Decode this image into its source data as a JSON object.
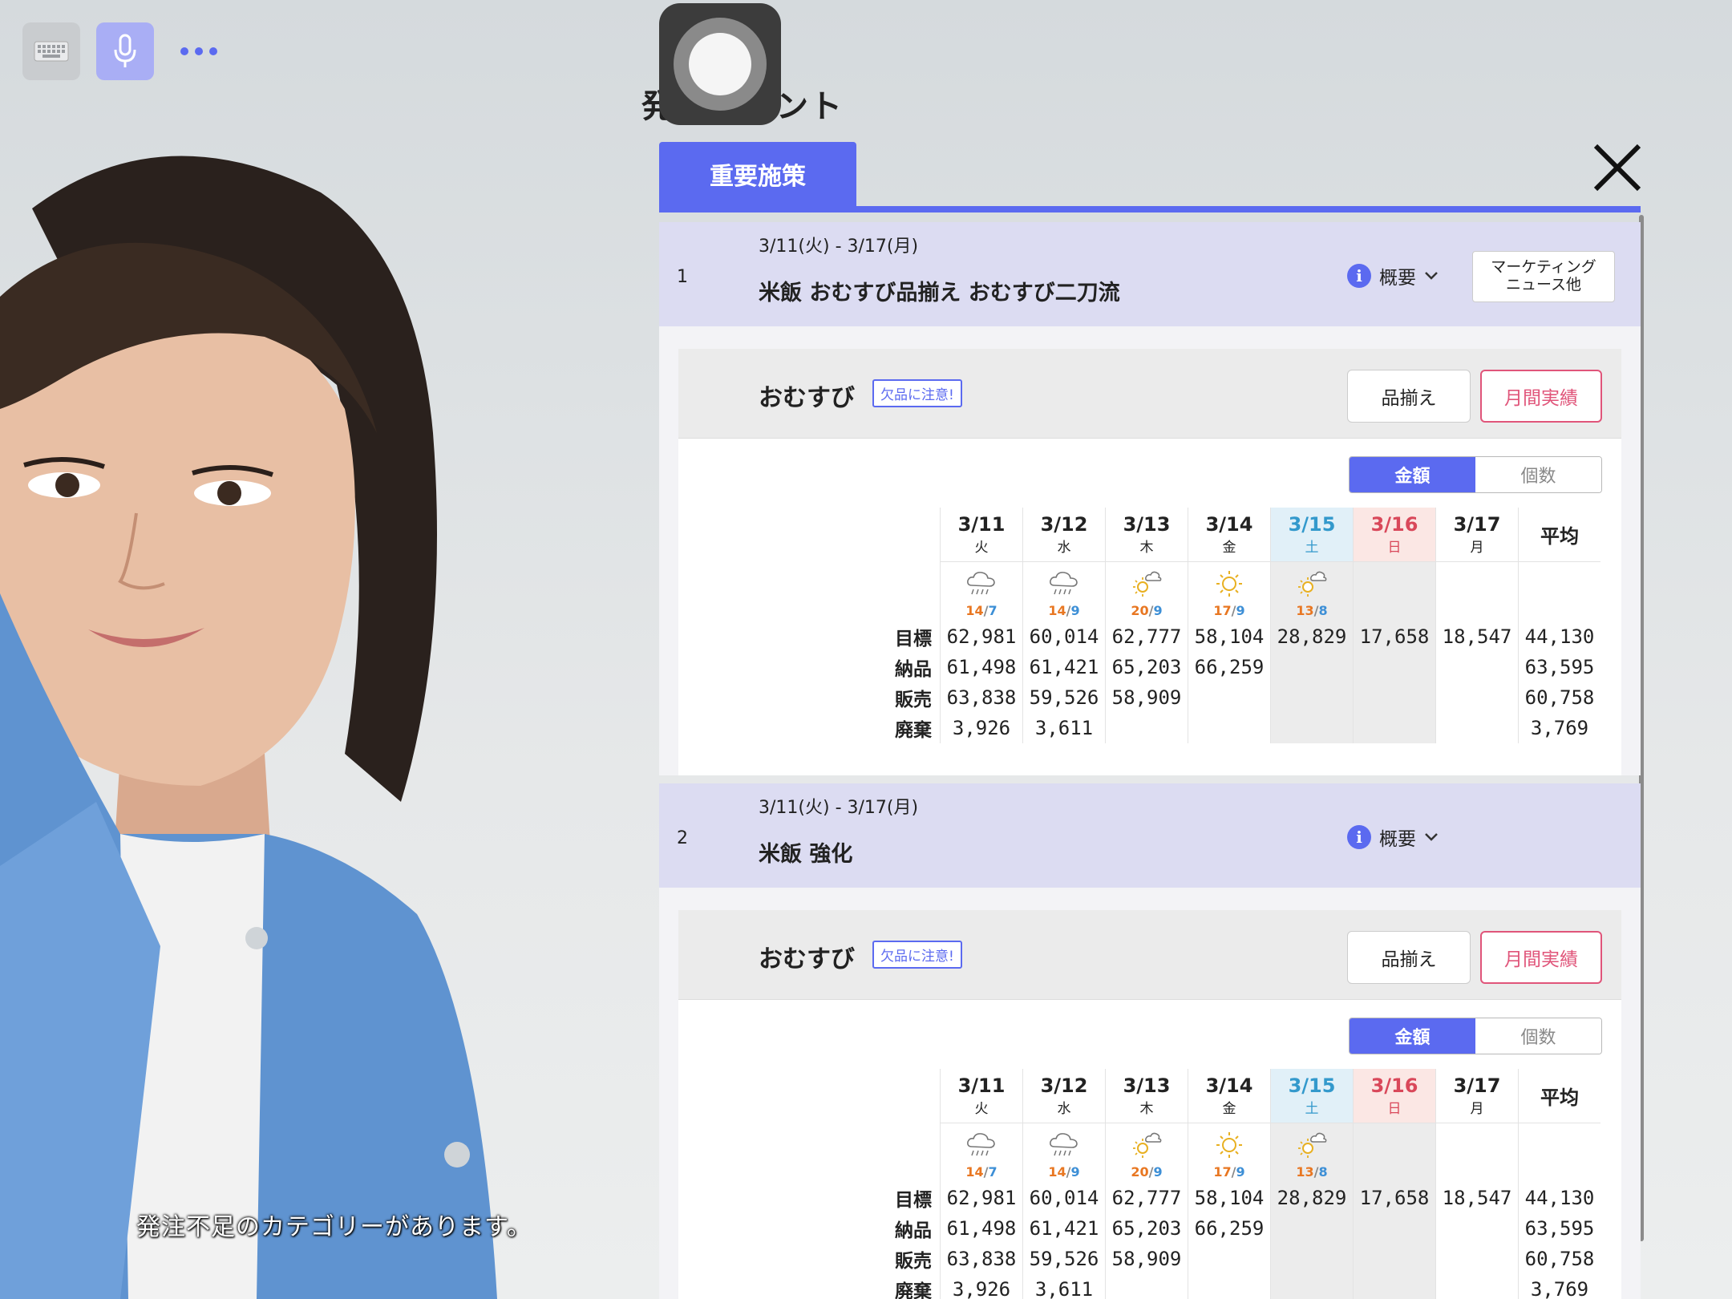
{
  "toolbar": {
    "keyboard_icon": "keyboard-icon",
    "mic_icon": "microphone-icon",
    "more_icon": "more-dots-icon"
  },
  "subtitle": "発注不足のカテゴリーがあります。",
  "panel": {
    "title": "発注ポイント",
    "tab": "重要施策"
  },
  "colors": {
    "accent": "#5b6af0",
    "monthly": "#e0557a",
    "header_bg": "#dcdcf2"
  },
  "measures": [
    {
      "index": "1",
      "date_range": "3/11(火) - 3/17(月)",
      "title": "米飯 おむすび品揃え おむすび二刀流",
      "overview_label": "概要",
      "marketing_label": "マーケティング\nニュース他",
      "category": {
        "name": "おむすび",
        "badge": "欠品に注意!",
        "assort_label": "品揃え",
        "monthly_label": "月間実績",
        "toggle_amount": "金額",
        "toggle_count": "個数",
        "days": [
          {
            "date": "3/11",
            "dow": "火",
            "weather": "rain",
            "hi": "14",
            "lo": "7"
          },
          {
            "date": "3/12",
            "dow": "水",
            "weather": "rain",
            "hi": "14",
            "lo": "9"
          },
          {
            "date": "3/13",
            "dow": "木",
            "weather": "sun-cloud",
            "hi": "20",
            "lo": "9"
          },
          {
            "date": "3/14",
            "dow": "金",
            "weather": "sun",
            "hi": "17",
            "lo": "9"
          },
          {
            "date": "3/15",
            "dow": "土",
            "weather": "sun-cloud",
            "hi": "13",
            "lo": "8"
          },
          {
            "date": "3/16",
            "dow": "日",
            "weather": "",
            "hi": "",
            "lo": ""
          },
          {
            "date": "3/17",
            "dow": "月",
            "weather": "",
            "hi": "",
            "lo": ""
          }
        ],
        "avg_label": "平均",
        "rows": [
          {
            "label": "目標",
            "values": [
              "62,981",
              "60,014",
              "62,777",
              "58,104",
              "28,829",
              "17,658",
              "18,547"
            ],
            "avg": "44,130"
          },
          {
            "label": "納品",
            "values": [
              "61,498",
              "61,421",
              "65,203",
              "66,259",
              "",
              "",
              ""
            ],
            "avg": "63,595"
          },
          {
            "label": "販売",
            "values": [
              "63,838",
              "59,526",
              "58,909",
              "",
              "",
              "",
              ""
            ],
            "avg": "60,758"
          },
          {
            "label": "廃棄",
            "values": [
              "3,926",
              "3,611",
              "",
              "",
              "",
              "",
              ""
            ],
            "avg": "3,769"
          }
        ]
      }
    },
    {
      "index": "2",
      "date_range": "3/11(火) - 3/17(月)",
      "title": "米飯 強化",
      "overview_label": "概要",
      "marketing_label": "",
      "category": {
        "name": "おむすび",
        "badge": "欠品に注意!",
        "assort_label": "品揃え",
        "monthly_label": "月間実績",
        "toggle_amount": "金額",
        "toggle_count": "個数",
        "days": [
          {
            "date": "3/11",
            "dow": "火",
            "weather": "rain",
            "hi": "14",
            "lo": "7"
          },
          {
            "date": "3/12",
            "dow": "水",
            "weather": "rain",
            "hi": "14",
            "lo": "9"
          },
          {
            "date": "3/13",
            "dow": "木",
            "weather": "sun-cloud",
            "hi": "20",
            "lo": "9"
          },
          {
            "date": "3/14",
            "dow": "金",
            "weather": "sun",
            "hi": "17",
            "lo": "9"
          },
          {
            "date": "3/15",
            "dow": "土",
            "weather": "sun-cloud",
            "hi": "13",
            "lo": "8"
          },
          {
            "date": "3/16",
            "dow": "日",
            "weather": "",
            "hi": "",
            "lo": ""
          },
          {
            "date": "3/17",
            "dow": "月",
            "weather": "",
            "hi": "",
            "lo": ""
          }
        ],
        "avg_label": "平均",
        "rows": [
          {
            "label": "目標",
            "values": [
              "62,981",
              "60,014",
              "62,777",
              "58,104",
              "28,829",
              "17,658",
              "18,547"
            ],
            "avg": "44,130"
          },
          {
            "label": "納品",
            "values": [
              "61,498",
              "61,421",
              "65,203",
              "66,259",
              "",
              "",
              ""
            ],
            "avg": "63,595"
          },
          {
            "label": "販売",
            "values": [
              "63,838",
              "59,526",
              "58,909",
              "",
              "",
              "",
              ""
            ],
            "avg": "60,758"
          },
          {
            "label": "廃棄",
            "values": [
              "3,926",
              "3,611",
              "",
              "",
              "",
              "",
              ""
            ],
            "avg": "3,769"
          }
        ]
      }
    }
  ]
}
